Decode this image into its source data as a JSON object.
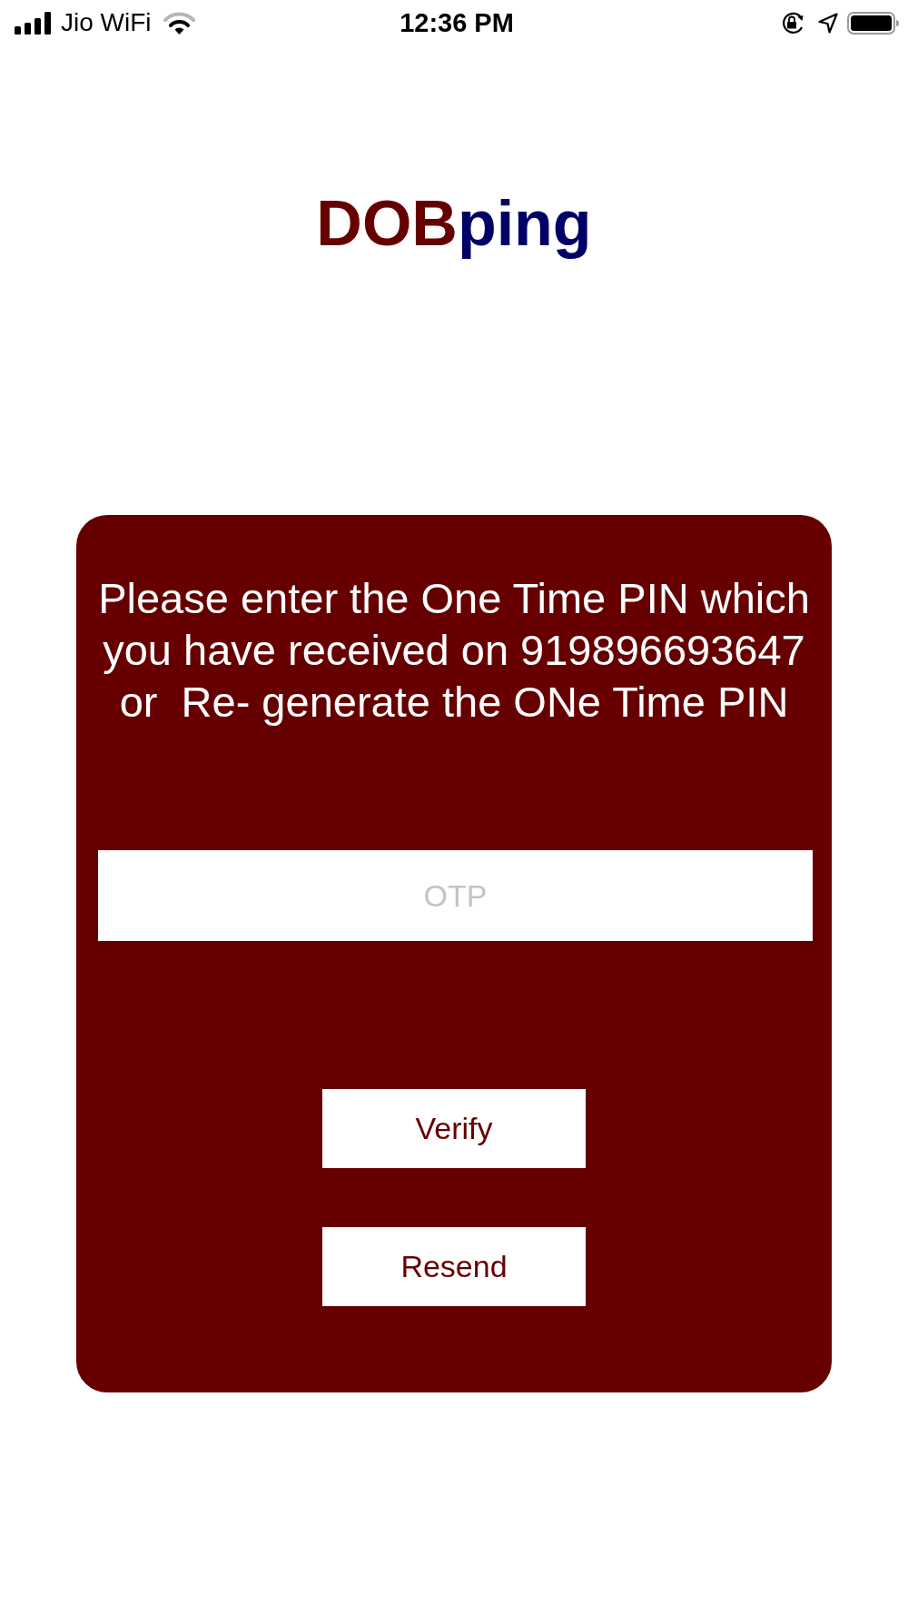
{
  "status_bar": {
    "carrier": "Jio WiFi",
    "time": "12:36 PM"
  },
  "logo": {
    "parts": [
      {
        "text": "DOB",
        "color": "#660000"
      },
      {
        "text": "ping",
        "color": "#000066"
      }
    ]
  },
  "otp_card": {
    "message": "Please enter the One Time PIN which you have received on 919896693647 or  Re- generate the ONe Time PIN",
    "otp_field": {
      "placeholder": "OTP"
    },
    "buttons": [
      "Verify",
      "Resend"
    ]
  }
}
